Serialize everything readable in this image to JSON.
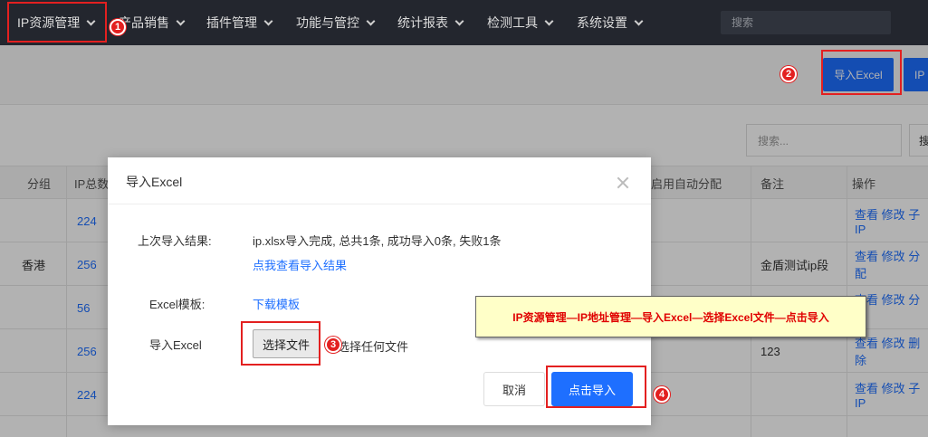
{
  "nav": {
    "items": [
      {
        "label": "IP资源管理"
      },
      {
        "label": "产品销售"
      },
      {
        "label": "插件管理"
      },
      {
        "label": "功能与管控"
      },
      {
        "label": "统计报表"
      },
      {
        "label": "检测工具"
      },
      {
        "label": "系统设置"
      }
    ],
    "search_placeholder": "搜索"
  },
  "toolbar": {
    "import_excel_label": "导入Excel",
    "second_button_label": "IP"
  },
  "filter": {
    "search_placeholder": "搜索...",
    "search_button_label": "搜"
  },
  "table": {
    "headers": {
      "group": "分组",
      "ip_total": "IP总数",
      "auto_assign": "启用自动分配",
      "remark": "备注",
      "actions": "操作"
    },
    "rows": [
      {
        "group": "",
        "ip_total": "224",
        "remark": "",
        "ops": "查看 修改 子IP"
      },
      {
        "group": "香港",
        "ip_total": "256",
        "remark": "金盾测试ip段",
        "ops": "查看 修改 分配"
      },
      {
        "group": "",
        "ip_total": "56",
        "remark": "",
        "ops": "查看 修改 分配"
      },
      {
        "group": "",
        "ip_total": "256",
        "remark": "123",
        "ops": "查看 修改 删除"
      },
      {
        "group": "",
        "ip_total": "224",
        "remark": "",
        "ops": "查看 修改 子IP"
      }
    ]
  },
  "modal": {
    "title": "导入Excel",
    "last_result_label": "上次导入结果:",
    "last_result_value": "ip.xlsx导入完成, 总共1条, 成功导入0条, 失败1条",
    "view_result_link": "点我查看导入结果",
    "template_label": "Excel模板:",
    "download_template_link": "下载模板",
    "import_label": "导入Excel",
    "choose_file_button": "选择文件",
    "no_file_text": "未选择任何文件",
    "cancel_button": "取消",
    "import_button": "点击导入"
  },
  "annotation": {
    "callout_text": "IP资源管理—IP地址管理—导入Excel—选择Excel文件—点击导入",
    "steps": [
      "1",
      "2",
      "3",
      "4"
    ],
    "color": "#e32020"
  },
  "colors": {
    "nav_bg": "#23262e",
    "primary": "#1e6fff",
    "callout_bg": "#ffffc8"
  }
}
